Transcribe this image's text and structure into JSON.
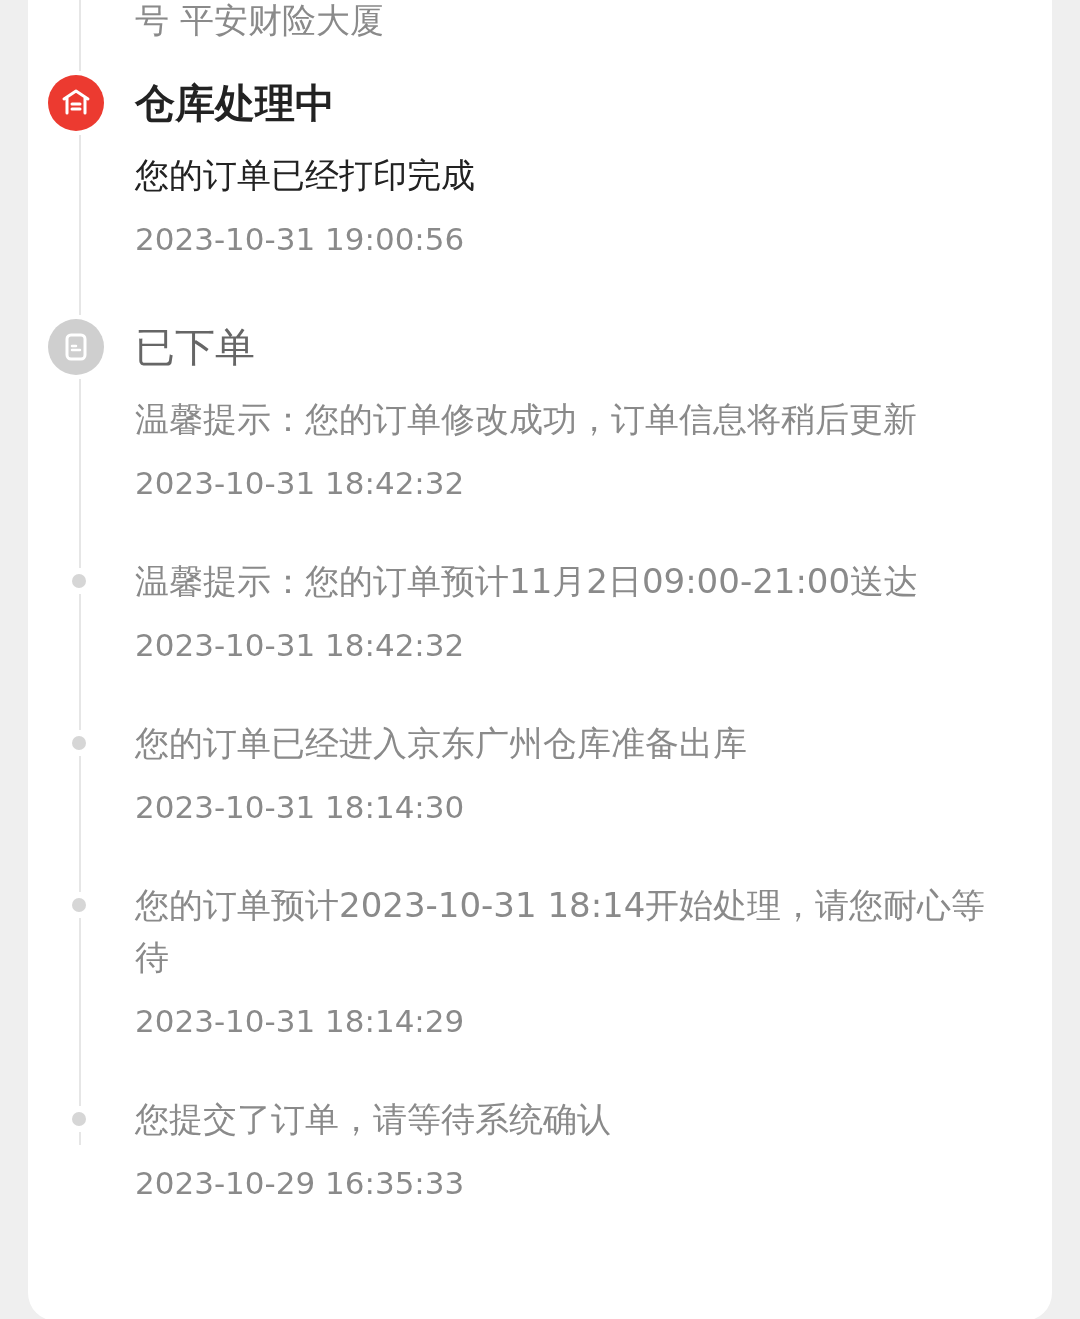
{
  "top_fragment": "号 平安财险大厦",
  "stages": [
    {
      "title": "仓库处理中",
      "selected": true,
      "kind": "warehouse",
      "events": [
        {
          "text": "您的订单已经打印完成",
          "time": "2023-10-31 19:00:56"
        }
      ]
    },
    {
      "title": "已下单",
      "selected": false,
      "kind": "order",
      "events": [
        {
          "text": "温馨提示：您的订单修改成功，订单信息将稍后更新",
          "time": "2023-10-31 18:42:32"
        },
        {
          "text": "温馨提示：您的订单预计11月2日09:00-21:00送达",
          "time": "2023-10-31 18:42:32"
        },
        {
          "text": "您的订单已经进入京东广州仓库准备出库",
          "time": "2023-10-31 18:14:30"
        },
        {
          "text": "您的订单预计2023-10-31 18:14开始处理，请您耐心等待",
          "time": "2023-10-31 18:14:29"
        },
        {
          "text": "您提交了订单，请等待系统确认",
          "time": "2023-10-29 16:35:33"
        }
      ]
    }
  ]
}
